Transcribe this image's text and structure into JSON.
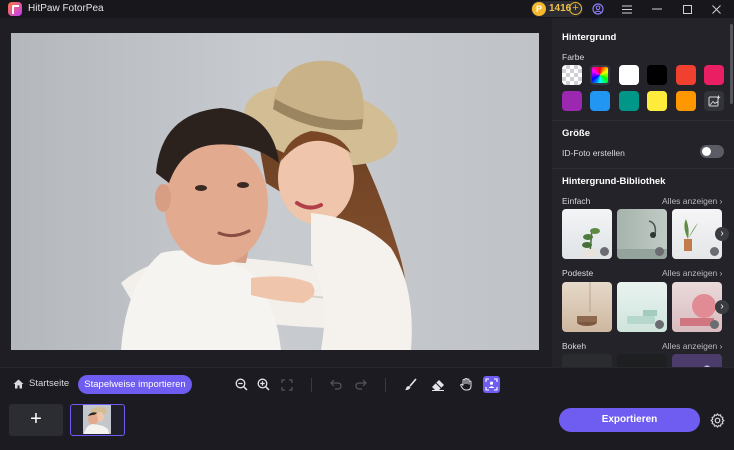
{
  "app": {
    "title": "HitPaw FotorPea"
  },
  "credits": {
    "coin_symbol": "P",
    "count": "1416",
    "add_symbol": "+"
  },
  "panel": {
    "background_title": "Hintergrund",
    "color_label": "Farbe",
    "swatches": [
      "transparent",
      "spectrum",
      "#ffffff",
      "#000000",
      "#f0402f",
      "#e91e63",
      "#9c27b0",
      "#2196f3",
      "#009688",
      "#ffeb3b",
      "#ff9800",
      "custom-image"
    ],
    "size_title": "Größe",
    "id_photo_label": "ID-Foto erstellen",
    "id_photo_enabled": false,
    "library_title": "Hintergrund-Bibliothek",
    "categories": [
      {
        "name": "Einfach",
        "view_all": "Alles anzeigen"
      },
      {
        "name": "Podeste",
        "view_all": "Alles anzeigen"
      },
      {
        "name": "Bokeh",
        "view_all": "Alles anzeigen"
      }
    ]
  },
  "toolbar": {
    "home_label": "Startseite",
    "batch_label": "Stapelweise importieren"
  },
  "strip": {
    "add_symbol": "+"
  },
  "export": {
    "label": "Exportieren"
  }
}
